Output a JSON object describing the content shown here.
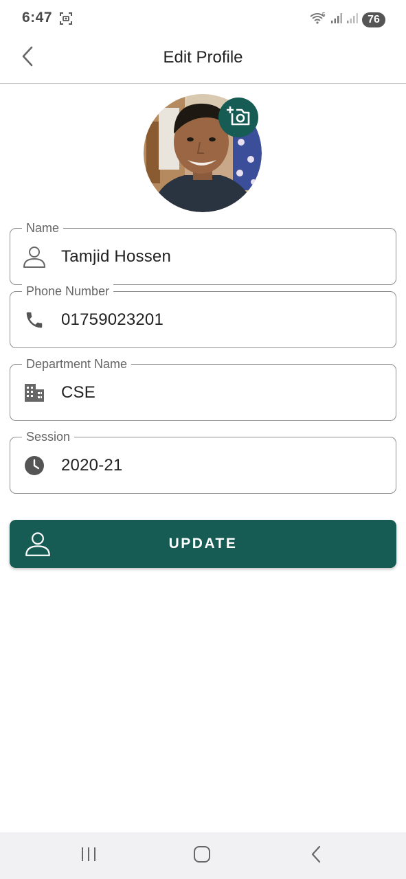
{
  "status_bar": {
    "time": "6:47",
    "battery": "76",
    "icons": [
      "screenshot-icon",
      "wifi-icon",
      "signal-icon",
      "signal-icon"
    ]
  },
  "app_bar": {
    "title": "Edit Profile",
    "back_icon": "chevron-left-icon"
  },
  "profile": {
    "avatar_alt": "profile-photo",
    "camera_icon": "add-photo-icon"
  },
  "fields": [
    {
      "label": "Name",
      "value": "Tamjid Hossen",
      "icon": "person-icon"
    },
    {
      "label": "Phone Number",
      "value": "01759023201",
      "icon": "phone-icon"
    },
    {
      "label": "Department Name",
      "value": "CSE",
      "icon": "building-icon"
    },
    {
      "label": "Session",
      "value": "2020-21",
      "icon": "clock-icon"
    }
  ],
  "update_button": {
    "label": "UPDATE",
    "icon": "person-icon"
  },
  "nav_bar": {
    "icons": [
      "recents-icon",
      "home-icon",
      "back-icon"
    ]
  },
  "colors": {
    "primary": "#165c54",
    "outline": "#8e8e8e",
    "label": "#666666",
    "nav_bg": "#f1f1f3"
  }
}
